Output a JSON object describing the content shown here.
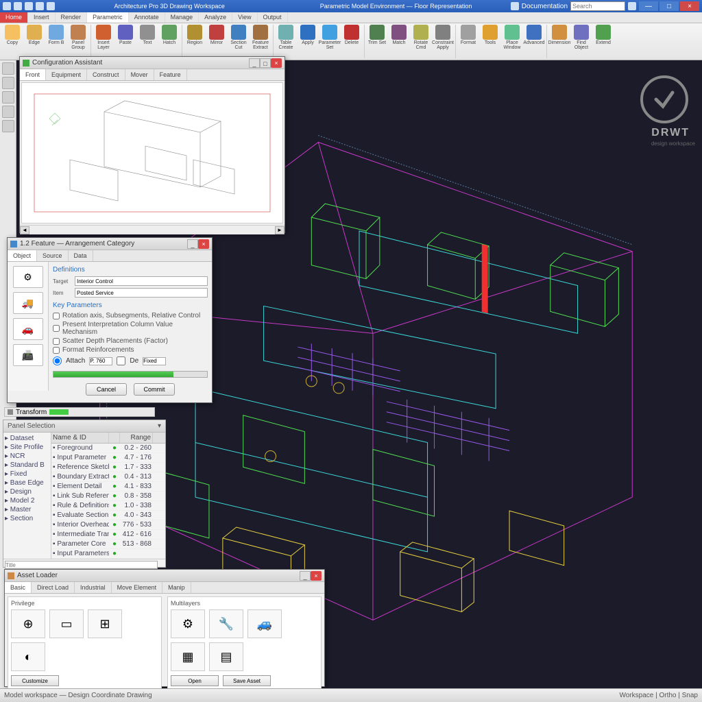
{
  "titlebar": {
    "title": "Architecture Pro 3D Drawing Workspace",
    "subtitle": "Parametric Model Environment — Floor Representation",
    "search_label": "Documentation",
    "search_ph": "Search"
  },
  "winctrl": {
    "min": "—",
    "max": "□",
    "close": "×"
  },
  "ribtabs": [
    "Home",
    "Insert",
    "Render",
    "Parametric",
    "Annotate",
    "Manage",
    "Analyze",
    "View",
    "Output"
  ],
  "ribtab_active": 3,
  "ribbon": [
    {
      "lbl": "Copy",
      "c": "#f4c060"
    },
    {
      "lbl": "Edge",
      "c": "#e0b050"
    },
    {
      "lbl": "Form B",
      "c": "#70a8e0"
    },
    {
      "lbl": "Panel Group",
      "c": "#c08050"
    },
    {
      "lbl": "Insert Layer",
      "c": "#d06030"
    },
    {
      "lbl": "Paste",
      "c": "#6060c0"
    },
    {
      "lbl": "Text",
      "c": "#909090"
    },
    {
      "lbl": "Hatch",
      "c": "#60a060"
    },
    {
      "lbl": "Region",
      "c": "#b09030"
    },
    {
      "lbl": "Mirror",
      "c": "#c04040"
    },
    {
      "lbl": "Section Cut",
      "c": "#4080c0"
    },
    {
      "lbl": "Feature Extract",
      "c": "#a07040"
    },
    {
      "lbl": "Table Create",
      "c": "#70b0b0"
    },
    {
      "lbl": "Apply",
      "c": "#3070c0"
    },
    {
      "lbl": "Parameter Set",
      "c": "#40a0e0"
    },
    {
      "lbl": "Delete",
      "c": "#c03030"
    },
    {
      "lbl": "Trim Set",
      "c": "#508050"
    },
    {
      "lbl": "Match",
      "c": "#805080"
    },
    {
      "lbl": "Rotate Cmd",
      "c": "#b0b050"
    },
    {
      "lbl": "Constraint Apply",
      "c": "#808080"
    },
    {
      "lbl": "Format",
      "c": "#a0a0a0"
    },
    {
      "lbl": "Tools",
      "c": "#e0a030"
    },
    {
      "lbl": "Place Window",
      "c": "#60c090"
    },
    {
      "lbl": "Advanced",
      "c": "#4070c0"
    },
    {
      "lbl": "Dimension",
      "c": "#d09040"
    },
    {
      "lbl": "Find Object",
      "c": "#7070c0"
    },
    {
      "lbl": "Extend",
      "c": "#50a050"
    }
  ],
  "watermark": {
    "text": "DRWT",
    "sub": "design workspace"
  },
  "dlg_preview": {
    "title": "Configuration Assistant",
    "tabs": [
      "Front",
      "Equipment",
      "Construct",
      "Mover",
      "Feature"
    ]
  },
  "dlg_settings": {
    "title": "1.2 Feature — Arrangement Category",
    "tabs": [
      "Object",
      "Source",
      "Data"
    ],
    "section1": "Definitions",
    "f1_label": "Target",
    "f1_val": "Interior Control",
    "f2_label": "Item",
    "f2_val": "Posted Service",
    "section2": "Key Parameters",
    "chk": [
      "Rotation axis, Subsegments, Relative Control",
      "Present Interpretation Column Value Mechanism",
      "Scatter Depth Placements (Factor)",
      "Format Reinforcements"
    ],
    "radio_a": "Attach",
    "radio_a_val": "P. 760",
    "radio_b": "De",
    "radio_b_val": "Fixed",
    "btn_cancel": "Cancel",
    "btn_commit": "Commit"
  },
  "bar600": {
    "label": "Transform"
  },
  "pnl_sel": {
    "title": "Panel Selection",
    "tree": [
      "Dataset",
      "Site Profile",
      "NCR",
      "Standard B",
      "Fixed",
      "Base Edge",
      "Design",
      "Model 2",
      "Master",
      "Section"
    ],
    "cols": [
      "Name & ID",
      "",
      "Range"
    ],
    "rows": [
      {
        "n": "Foreground",
        "v": "0.2 - 260"
      },
      {
        "n": "Input Parameter",
        "v": "4.7 - 176"
      },
      {
        "n": "Reference Sketch",
        "v": "1.7 - 333"
      },
      {
        "n": "Boundary Extract",
        "v": "0.4 - 313"
      },
      {
        "n": "Element Detail",
        "v": "4.1 - 833"
      },
      {
        "n": "Link Sub Reference",
        "v": "0.8 - 358"
      },
      {
        "n": "Rule & Definitions",
        "v": "1.0 - 338"
      },
      {
        "n": "Evaluate Section",
        "v": "4.0 - 343"
      },
      {
        "n": "Interior Overhead Form",
        "v": "776 - 533"
      },
      {
        "n": "Intermediate Transform",
        "v": "412 - 616"
      },
      {
        "n": "Parameter Core",
        "v": "513 - 868"
      },
      {
        "n": "Input Parameters",
        "v": ""
      }
    ],
    "footer_ph": "Title"
  },
  "dlg_asset": {
    "title": "Asset Loader",
    "tabs": [
      "Basic",
      "Direct Load",
      "Industrial",
      "Move Element",
      "Manip"
    ],
    "grp1": "Privilege",
    "grp2": "Multilayers",
    "btn1": "Customize",
    "btn2": "Open",
    "btn3": "Save Asset"
  },
  "status": {
    "l": "Model workspace — Design Coordinate Drawing",
    "r": "Workspace  |  Ortho  |  Snap"
  }
}
